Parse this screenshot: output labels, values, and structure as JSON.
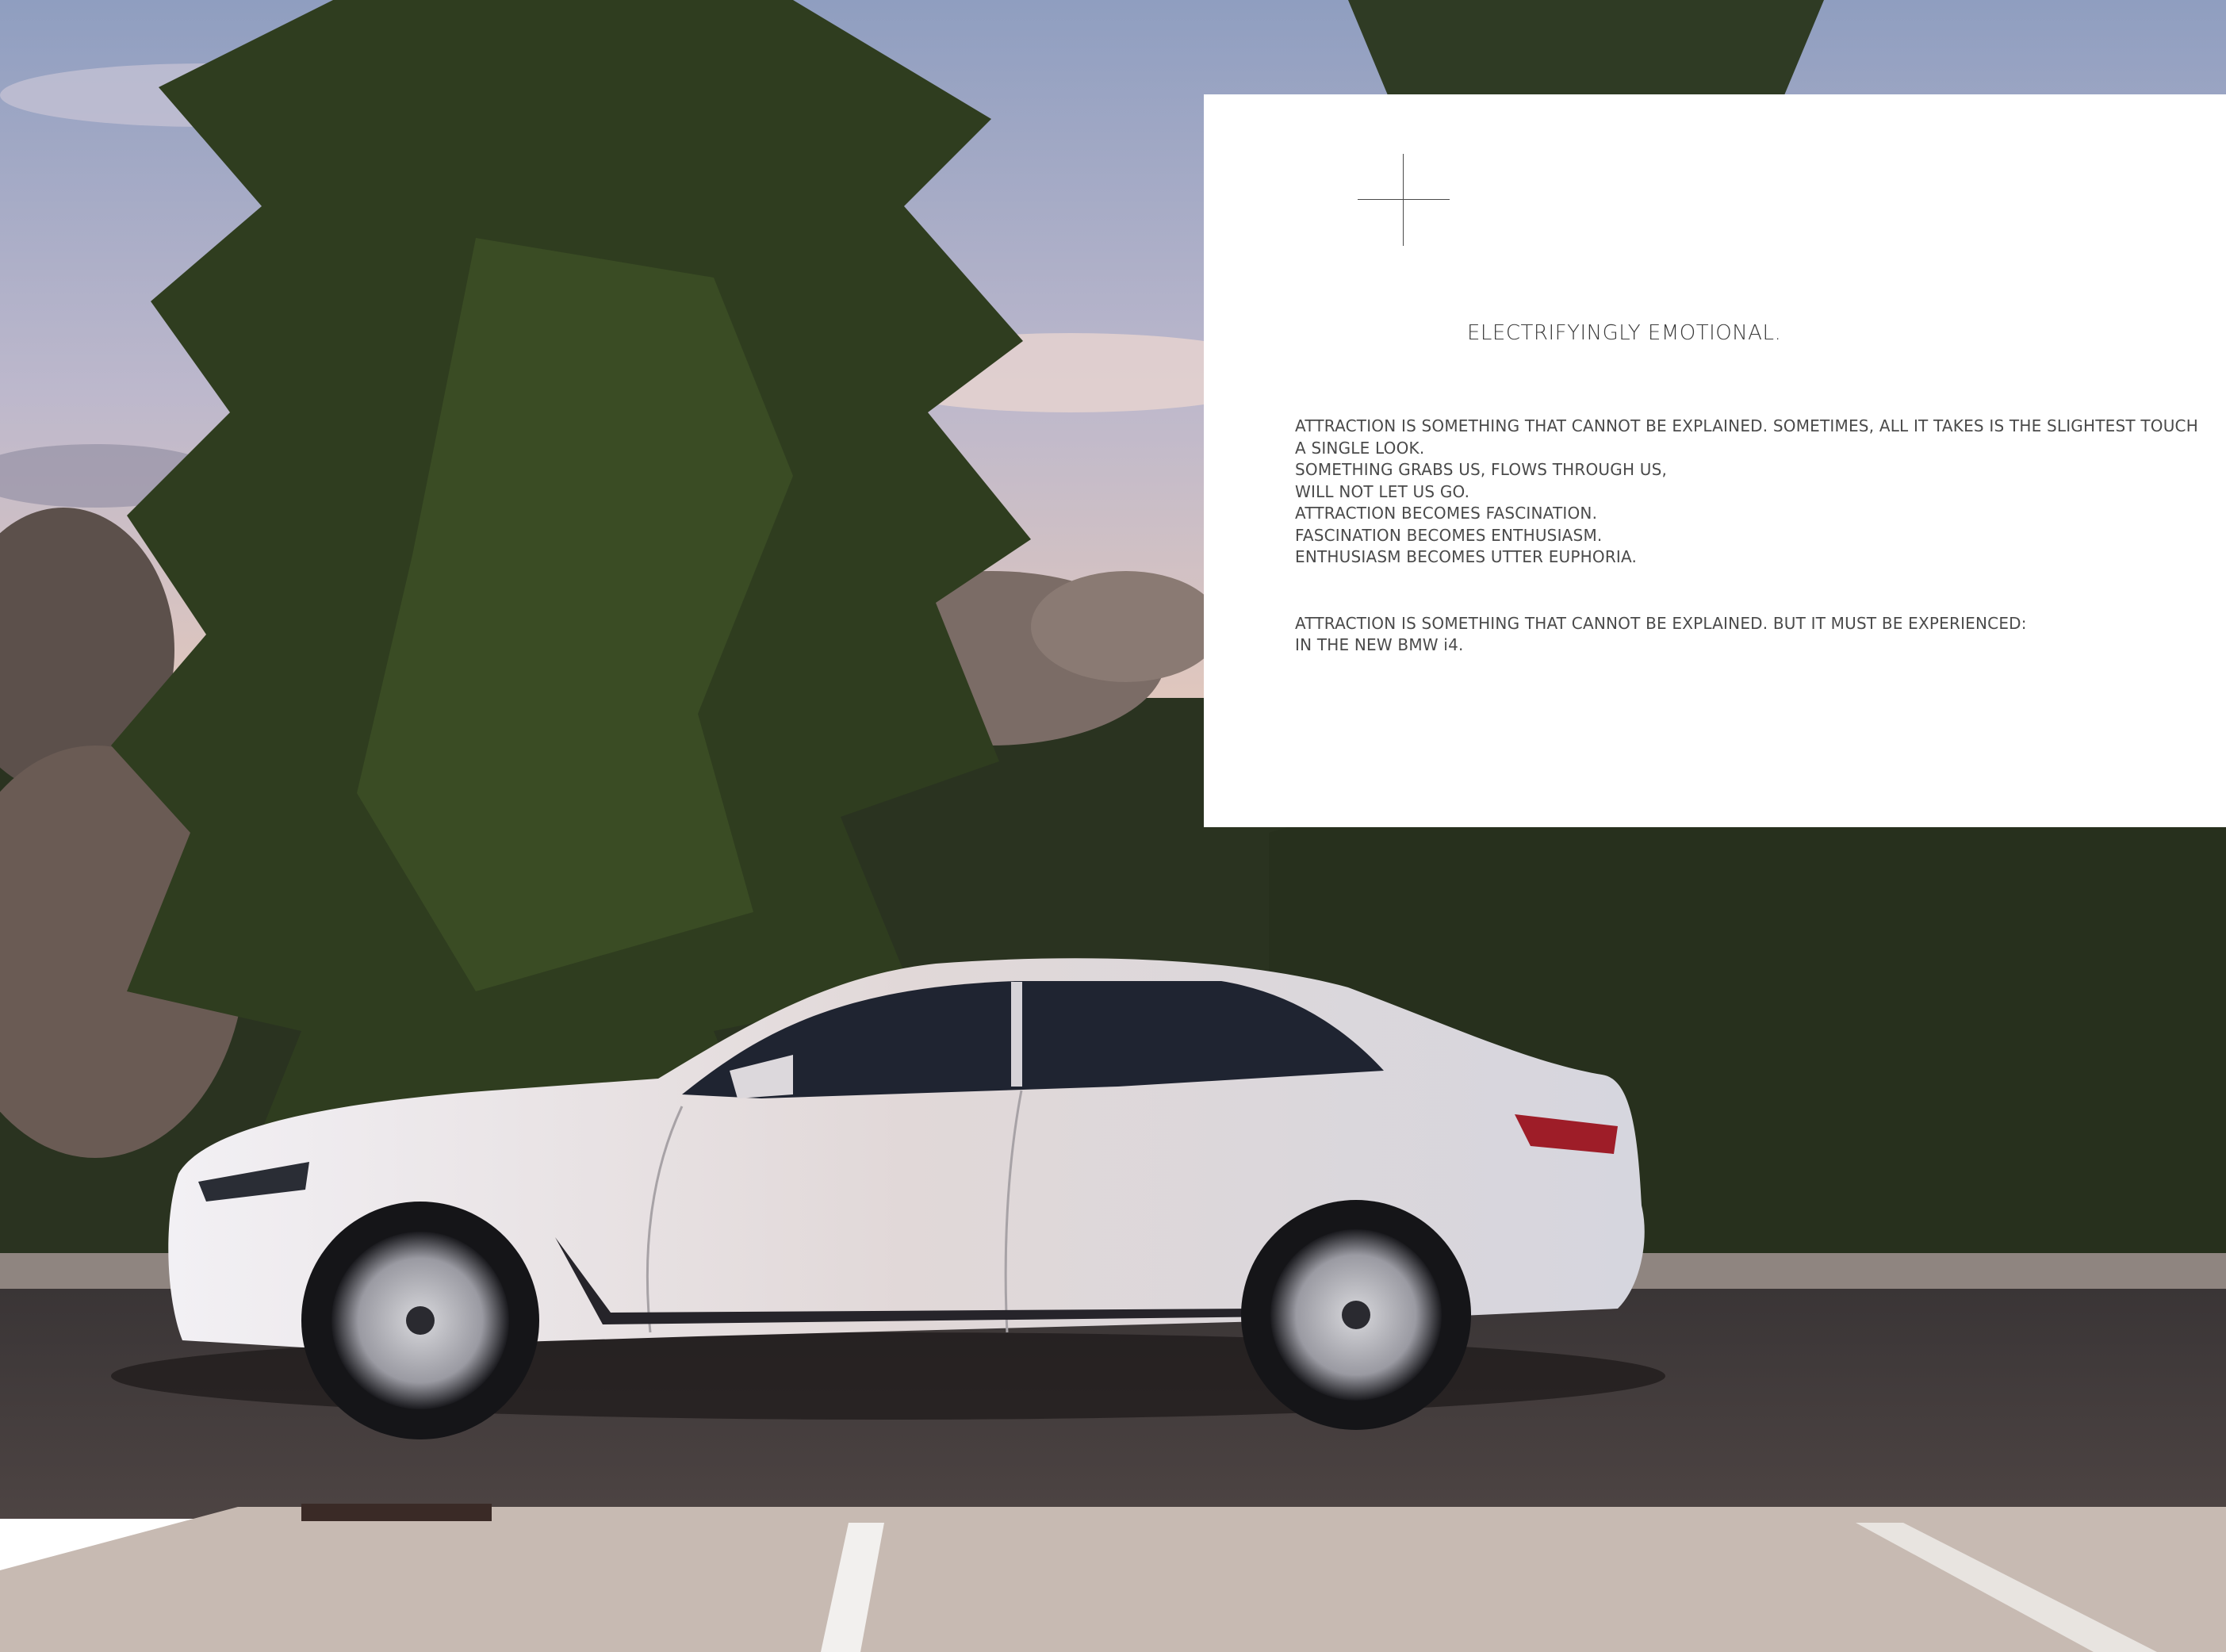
{
  "page": {
    "headline": "ELECTRIFYINGLY EMOTIONAL.",
    "paragraph1": [
      "ATTRACTION IS SOMETHING THAT CANNOT BE EXPLAINED. SOMETIMES, ALL IT TAKES IS THE SLIGHTEST TOUCH",
      "A SINGLE LOOK.",
      "SOMETHING GRABS US, FLOWS THROUGH US,",
      "WILL NOT LET US GO.",
      "ATTRACTION BECOMES FASCINATION.",
      "FASCINATION BECOMES ENTHUSIASM.",
      "ENTHUSIASM BECOMES UTTER EUPHORIA."
    ],
    "paragraph2": [
      "ATTRACTION IS SOMETHING THAT CANNOT BE EXPLAINED. BUT IT MUST BE EXPERIENCED:",
      "IN THE NEW BMW i4."
    ]
  },
  "photo": {
    "icon": "photo-bmw-i4-car",
    "colors": {
      "sky_top": "#9aa7c4",
      "sky_low": "#d9c4bd",
      "tree": "#2f3b1f",
      "rock": "#6e5f58",
      "road": "#3f3a3a",
      "pavement": "#c6b9b1",
      "car_body": "#e9e6ea",
      "car_glass": "#1e2330",
      "taillight": "#a0202a"
    }
  },
  "decor": {
    "icon": "crosshair-icon",
    "color": "#4a4a4a"
  }
}
